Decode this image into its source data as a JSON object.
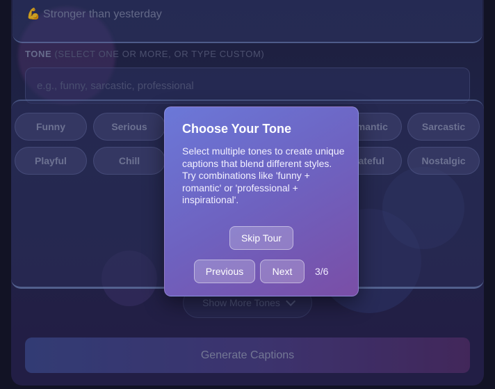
{
  "mood": {
    "emoji": "💪",
    "text": "Stronger than yesterday"
  },
  "tone_section": {
    "label": "TONE",
    "hint": "(SELECT ONE OR MORE, OR TYPE CUSTOM)",
    "placeholder": "e.g., funny, sarcastic, professional"
  },
  "tones": [
    {
      "label": "Funny"
    },
    {
      "label": "Serious"
    },
    {
      "label": "Romantic"
    },
    {
      "label": "Sarcastic"
    },
    {
      "label": "Playful"
    },
    {
      "label": "Chill"
    },
    {
      "label": "Grateful"
    },
    {
      "label": "Nostalgic"
    }
  ],
  "show_more_label": "Show More Tones",
  "generate_label": "Generate Captions",
  "tour": {
    "title": "Choose Your Tone",
    "text": "Select multiple tones to create unique captions that blend different styles. Try combinations like 'funny + romantic' or 'professional + inspirational'.",
    "skip_label": "Skip Tour",
    "previous_label": "Previous",
    "next_label": "Next",
    "progress": "3/6"
  }
}
